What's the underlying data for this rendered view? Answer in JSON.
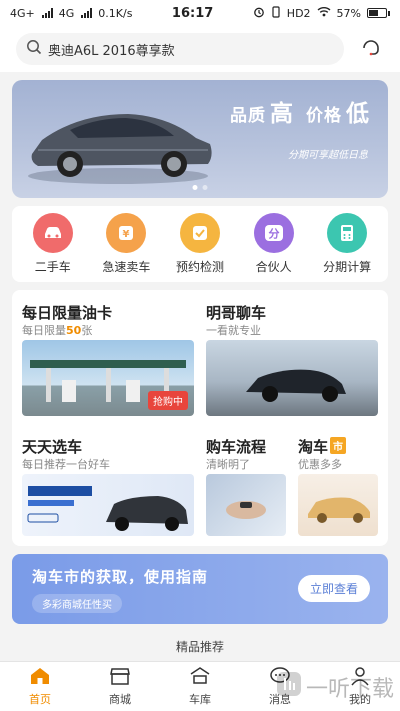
{
  "status_bar": {
    "network1": "4G+",
    "network2": "4G",
    "speed": "0.1K/s",
    "time": "16:17",
    "hd": "HD2",
    "battery": "57%",
    "battery_level": 0.57
  },
  "search": {
    "text": "奥迪A6L 2016尊享款"
  },
  "banner": {
    "title_part1": "品质",
    "title_big1": "高",
    "title_part2": "价格",
    "title_big2": "低",
    "subtitle": "分期可享超低日息",
    "slide_count": 2,
    "active_slide": 1
  },
  "quick_menu": [
    {
      "label": "二手车",
      "icon": "car-icon",
      "color": "#f06b6b"
    },
    {
      "label": "急速卖车",
      "icon": "yen-icon",
      "color": "#f5a24b"
    },
    {
      "label": "预约检测",
      "icon": "check-icon",
      "color": "#f5b540"
    },
    {
      "label": "合伙人",
      "icon": "fen-icon",
      "color": "#9b6fe0"
    },
    {
      "label": "分期计算",
      "icon": "calculator-icon",
      "color": "#3cc6b0"
    }
  ],
  "features": {
    "fuel_card": {
      "title": "每日限量油卡",
      "sub_prefix": "每日限量",
      "sub_highlight": "50",
      "sub_suffix": "张",
      "badge": "抢购中"
    },
    "chat": {
      "title": "明哥聊车",
      "sub": "一看就专业"
    },
    "daily_pick": {
      "title": "天天选车",
      "sub": "每日推荐一台好车"
    },
    "process": {
      "title": "购车流程",
      "sub": "清晰明了"
    },
    "taoche": {
      "title": "淘车",
      "tag": "市",
      "sub": "优惠多多"
    }
  },
  "guide": {
    "title": "淘车市的获取，使用指南",
    "subtitle": "多彩商城任性买",
    "button": "立即查看"
  },
  "recommend_title": "精品推荐",
  "tabs": [
    {
      "label": "首页",
      "icon": "home-icon",
      "active": true
    },
    {
      "label": "商城",
      "icon": "shop-icon",
      "active": false
    },
    {
      "label": "车库",
      "icon": "garage-icon",
      "active": false
    },
    {
      "label": "消息",
      "icon": "message-icon",
      "active": false
    },
    {
      "label": "我的",
      "icon": "profile-icon",
      "active": false
    }
  ],
  "watermark": "一听下载",
  "colors": {
    "accent": "#f08c00",
    "guide": "#7a9be8"
  }
}
